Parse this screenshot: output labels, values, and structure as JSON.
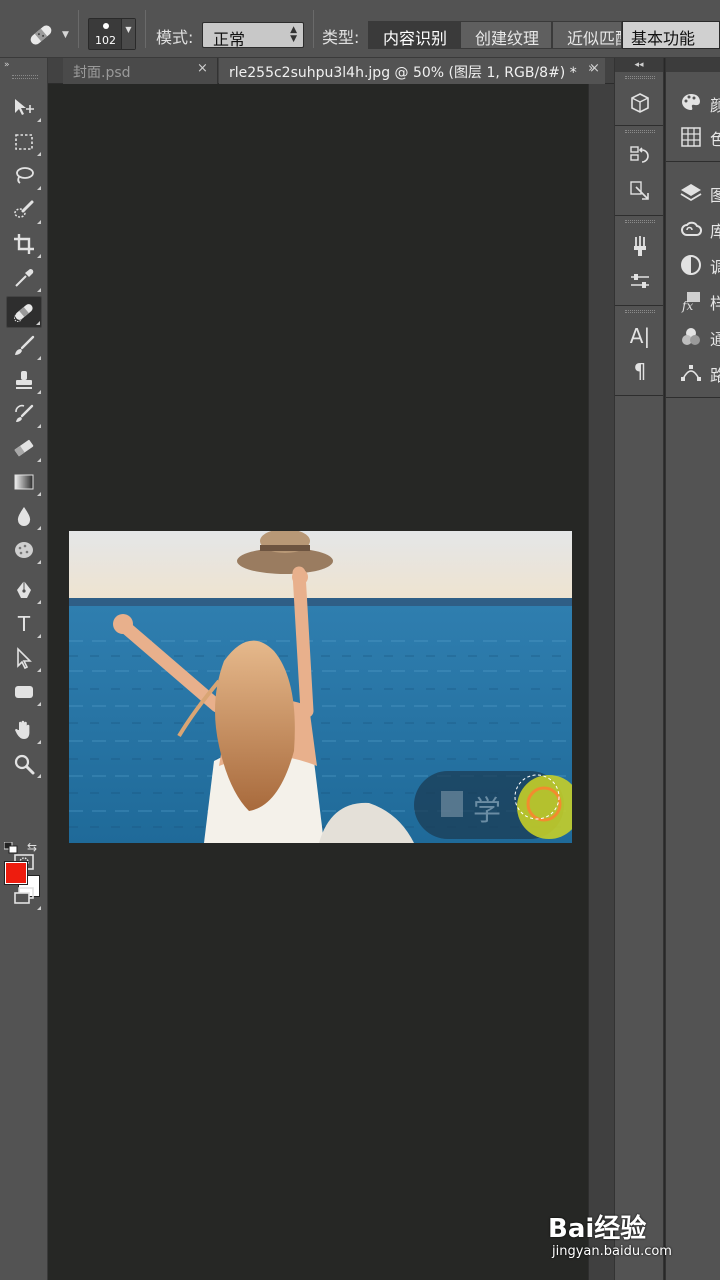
{
  "options_bar": {
    "brush_size": "102",
    "mode_label": "模式:",
    "mode_value": "正常",
    "type_label": "类型:",
    "type_options": [
      "内容识别",
      "创建纹理",
      "近似匹配"
    ],
    "type_active": "内容识别",
    "workspace": "基本功能"
  },
  "tools": [
    {
      "name": "move-tool",
      "icon": "move-icon"
    },
    {
      "name": "marquee-tool",
      "icon": "rect-marquee-icon"
    },
    {
      "name": "lasso-tool",
      "icon": "lasso-icon"
    },
    {
      "name": "quick-selection-tool",
      "icon": "quick-select-icon"
    },
    {
      "name": "crop-tool",
      "icon": "crop-icon"
    },
    {
      "name": "eyedropper-tool",
      "icon": "eyedropper-icon"
    },
    {
      "name": "spot-healing-tool",
      "icon": "bandage-icon"
    },
    {
      "name": "brush-tool",
      "icon": "brush-icon"
    },
    {
      "name": "clone-stamp-tool",
      "icon": "stamp-icon"
    },
    {
      "name": "history-brush-tool",
      "icon": "history-brush-icon"
    },
    {
      "name": "eraser-tool",
      "icon": "eraser-icon"
    },
    {
      "name": "gradient-tool",
      "icon": "gradient-icon"
    },
    {
      "name": "blur-tool",
      "icon": "droplet-icon"
    },
    {
      "name": "dodge-tool",
      "icon": "sponge-icon"
    },
    {
      "name": "pen-tool",
      "icon": "pen-icon"
    },
    {
      "name": "type-tool",
      "icon": "type-icon"
    },
    {
      "name": "path-selection-tool",
      "icon": "arrow-icon"
    },
    {
      "name": "shape-tool",
      "icon": "rounded-rect-icon"
    },
    {
      "name": "hand-tool",
      "icon": "hand-icon"
    },
    {
      "name": "zoom-tool",
      "icon": "zoom-icon"
    }
  ],
  "colors": {
    "foreground": "#ee1c0e",
    "background": "#ffffff"
  },
  "document_tabs": [
    {
      "title": "封面.psd",
      "active": false
    },
    {
      "title": "rle255c2suhpu3l4h.jpg @ 50% (图层 1, RGB/8#) *",
      "active": true
    }
  ],
  "tab_close": "×",
  "overflow": "»",
  "collapse": "◂◂",
  "right_panels": {
    "labels": [
      "颜",
      "色",
      "图",
      "库",
      "调",
      "样",
      "通",
      "路"
    ]
  },
  "photo_overlay_text": "学",
  "watermark": {
    "logo": "Bai经验",
    "url": "jingyan.baidu.com"
  }
}
